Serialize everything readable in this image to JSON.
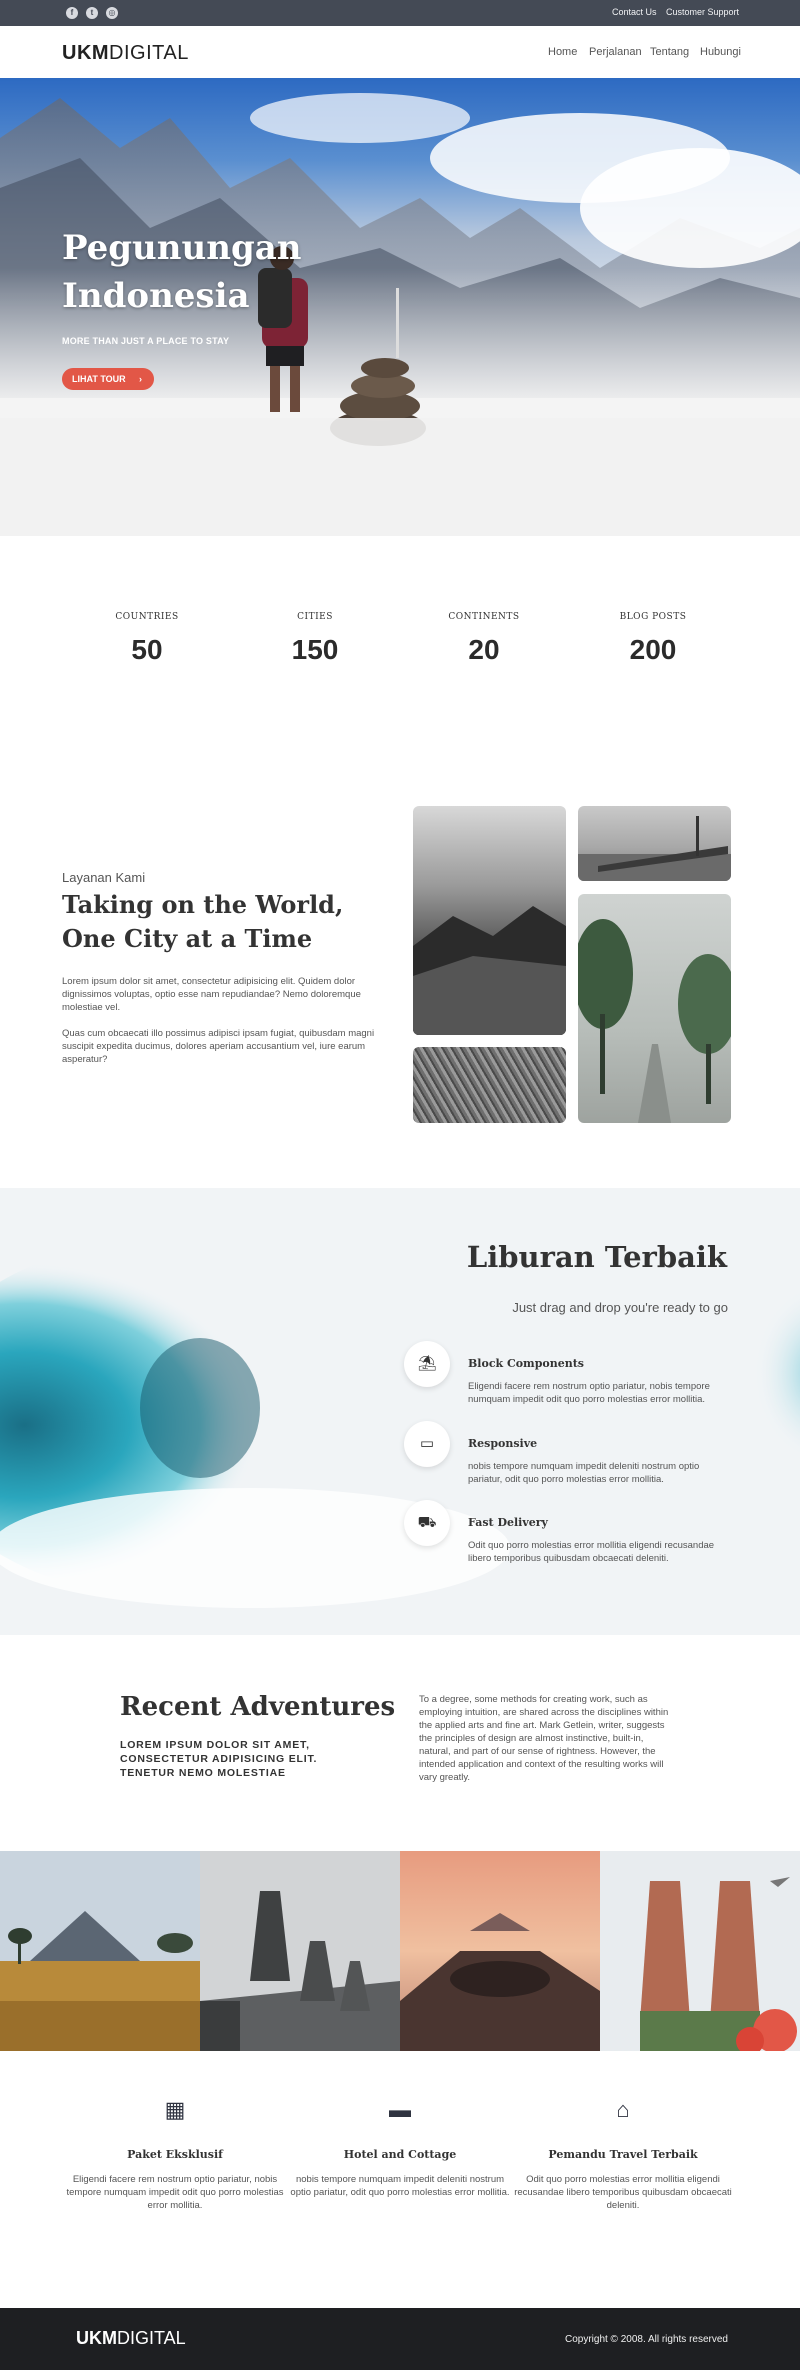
{
  "topbar": {
    "social": [
      {
        "icon": "facebook-icon",
        "glyph": "f"
      },
      {
        "icon": "twitter-icon",
        "glyph": "t"
      },
      {
        "icon": "instagram-icon",
        "glyph": "◎"
      }
    ],
    "links": [
      "Contact Us",
      "Customer Support"
    ]
  },
  "header": {
    "logo_bold": "UKM",
    "logo_light": "DIGITAL",
    "nav": [
      "Home",
      "Perjalanan",
      "Tentang",
      "Hubungi"
    ]
  },
  "hero": {
    "title": "Pegunungan Indonesia",
    "tagline": "MORE THAN JUST A PLACE TO STAY",
    "cta": "LIHAT TOUR",
    "cta_icon": "›"
  },
  "stats": [
    {
      "label": "COUNTRIES",
      "value": "50"
    },
    {
      "label": "CITIES",
      "value": "150"
    },
    {
      "label": "CONTINENTS",
      "value": "20"
    },
    {
      "label": "BLOG POSTS",
      "value": "200"
    }
  ],
  "services": {
    "kicker": "Layanan Kami",
    "title": "Taking on the World, One City at a Time",
    "paragraphs": [
      "Lorem ipsum dolor sit amet, consectetur adipisicing elit. Quidem dolor dignissimos voluptas, optio esse nam repudiandae? Nemo doloremque molestiae vel.",
      "Quas cum obcaecati illo possimus adipisci ipsam fugiat, quibusdam magni suscipit expedita ducimus, dolores aperiam accusantium vel, iure earum asperatur?"
    ]
  },
  "holiday": {
    "title": "Liburan Terbaik",
    "subtitle": "Just drag and drop you're ready to go",
    "features": [
      {
        "icon": "beach-umbrella-icon",
        "glyph": "⛱",
        "title": "Block Components",
        "desc": "Eligendi facere rem nostrum optio pariatur, nobis tempore numquam impedit odit quo porro molestias error mollitia."
      },
      {
        "icon": "laptop-icon",
        "glyph": "▭",
        "title": "Responsive",
        "desc": "nobis tempore numquam impedit deleniti nostrum optio pariatur, odit quo porro molestias error mollitia."
      },
      {
        "icon": "truck-icon",
        "glyph": "⛟",
        "title": "Fast Delivery",
        "desc": "Odit quo porro molestias error mollitia eligendi recusandae libero temporibus quibusdam obcaecati deleniti."
      }
    ]
  },
  "recent": {
    "title": "Recent Adventures",
    "subtitle": "LOREM IPSUM DOLOR SIT AMET, CONSECTETUR ADIPISICING ELIT. TENETUR NEMO MOLESTIAE",
    "text": "To a degree, some methods for creating work, such as employing intuition, are shared across the disciplines within the applied arts and fine art. Mark Getlein, writer, suggests the principles of design are almost instinctive, built-in, natural, and part of our sense of rightness. However, the intended application and context of the resulting works will vary greatly."
  },
  "packages": [
    {
      "icon": "hotel-building-icon",
      "glyph": "▦",
      "title": "Paket Eksklusif",
      "desc": "Eligendi facere rem nostrum optio pariatur, nobis tempore numquam impedit odit quo porro molestias error mollitia."
    },
    {
      "icon": "couch-icon",
      "glyph": "▬",
      "title": "Hotel and Cottage",
      "desc": "nobis tempore numquam impedit deleniti nostrum optio pariatur, odit quo porro molestias error mollitia."
    },
    {
      "icon": "store-icon",
      "glyph": "⌂",
      "title": "Pemandu Travel Terbaik",
      "desc": "Odit quo porro molestias error mollitia eligendi recusandae libero temporibus quibusdam obcaecati deleniti."
    }
  ],
  "footer": {
    "logo_bold": "UKM",
    "logo_light": "DIGITAL",
    "copyright": "Copyright © 2008. All rights reserved"
  },
  "colors": {
    "topbar": "#444a55",
    "accent": "#e25747",
    "footer": "#1e1f22"
  }
}
